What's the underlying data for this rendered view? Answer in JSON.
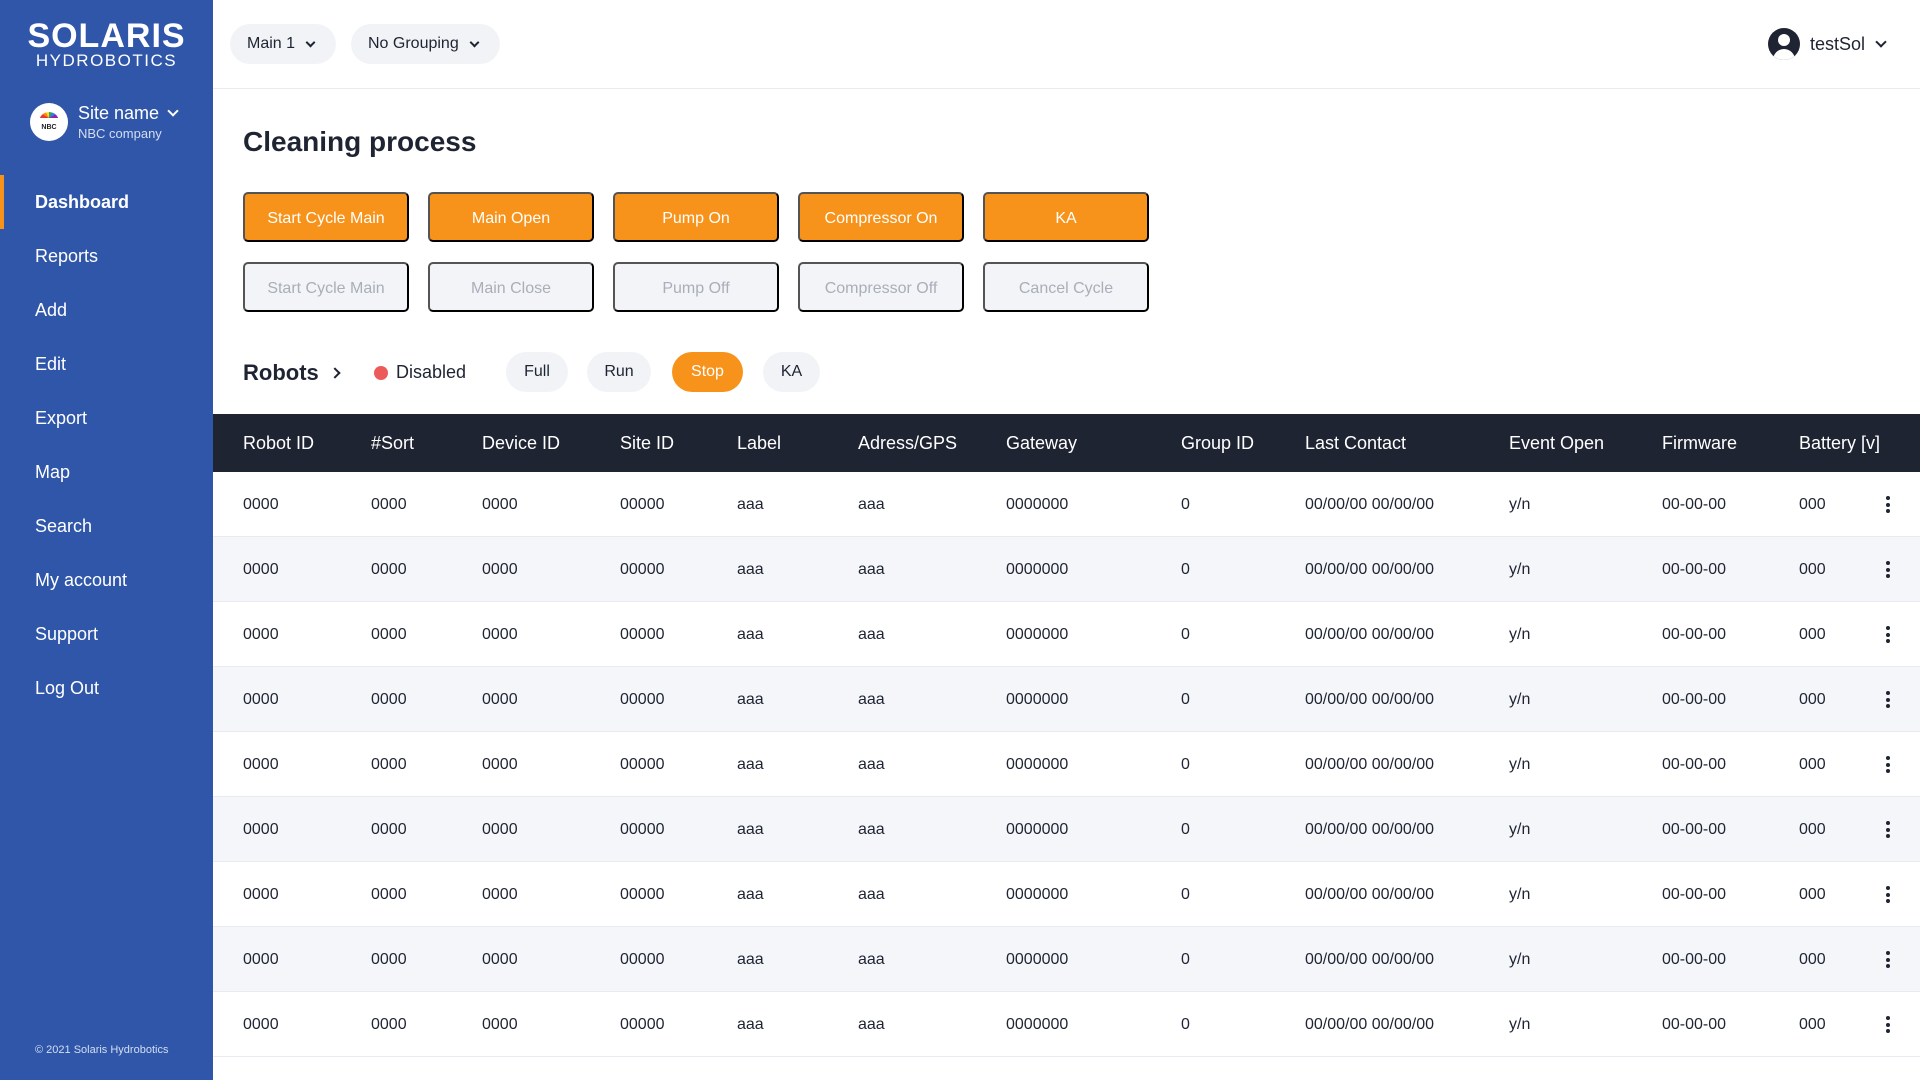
{
  "brand": {
    "name": "SOLARIS",
    "sub": "HYDROBOTICS"
  },
  "site": {
    "avatar_text": "NBC",
    "name": "Site name",
    "company": "NBC company"
  },
  "nav": [
    {
      "label": "Dashboard",
      "active": true
    },
    {
      "label": "Reports"
    },
    {
      "label": "Add"
    },
    {
      "label": "Edit"
    },
    {
      "label": "Export"
    },
    {
      "label": "Map"
    },
    {
      "label": "Search"
    },
    {
      "label": "My account"
    },
    {
      "label": "Support"
    },
    {
      "label": "Log Out"
    }
  ],
  "copyright": "© 2021 Solaris Hydrobotics",
  "topbar": {
    "main_select": "Main 1",
    "grouping_select": "No Grouping",
    "username": "testSol"
  },
  "page_title": "Cleaning process",
  "actions_primary": [
    "Start Cycle Main",
    "Main Open",
    "Pump On",
    "Compressor On",
    "KA"
  ],
  "actions_secondary": [
    "Start Cycle Main",
    "Main Close",
    "Pump Off",
    "Compressor Off",
    "Cancel Cycle"
  ],
  "robots": {
    "title": "Robots",
    "status": "Disabled",
    "filters": [
      "Full",
      "Run",
      "Stop",
      "KA"
    ],
    "active_filter": "Stop"
  },
  "colors": {
    "sidebar": "#2f56a9",
    "accent": "#f7931a",
    "table_header": "#1f2433",
    "status_disabled": "#ec5a5a"
  },
  "table": {
    "columns": [
      "Robot ID",
      "#Sort",
      "Device ID",
      "Site ID",
      "Label",
      "Adress/GPS",
      "Gateway",
      "Group ID",
      "Last Contact",
      "Event Open",
      "Firmware",
      "Battery [v]"
    ],
    "rows": [
      [
        "0000",
        "0000",
        "0000",
        "00000",
        "aaa",
        "aaa",
        "0000000",
        "0",
        "00/00/00 00/00/00",
        "y/n",
        "00-00-00",
        "000"
      ],
      [
        "0000",
        "0000",
        "0000",
        "00000",
        "aaa",
        "aaa",
        "0000000",
        "0",
        "00/00/00 00/00/00",
        "y/n",
        "00-00-00",
        "000"
      ],
      [
        "0000",
        "0000",
        "0000",
        "00000",
        "aaa",
        "aaa",
        "0000000",
        "0",
        "00/00/00 00/00/00",
        "y/n",
        "00-00-00",
        "000"
      ],
      [
        "0000",
        "0000",
        "0000",
        "00000",
        "aaa",
        "aaa",
        "0000000",
        "0",
        "00/00/00 00/00/00",
        "y/n",
        "00-00-00",
        "000"
      ],
      [
        "0000",
        "0000",
        "0000",
        "00000",
        "aaa",
        "aaa",
        "0000000",
        "0",
        "00/00/00 00/00/00",
        "y/n",
        "00-00-00",
        "000"
      ],
      [
        "0000",
        "0000",
        "0000",
        "00000",
        "aaa",
        "aaa",
        "0000000",
        "0",
        "00/00/00 00/00/00",
        "y/n",
        "00-00-00",
        "000"
      ],
      [
        "0000",
        "0000",
        "0000",
        "00000",
        "aaa",
        "aaa",
        "0000000",
        "0",
        "00/00/00 00/00/00",
        "y/n",
        "00-00-00",
        "000"
      ],
      [
        "0000",
        "0000",
        "0000",
        "00000",
        "aaa",
        "aaa",
        "0000000",
        "0",
        "00/00/00 00/00/00",
        "y/n",
        "00-00-00",
        "000"
      ],
      [
        "0000",
        "0000",
        "0000",
        "00000",
        "aaa",
        "aaa",
        "0000000",
        "0",
        "00/00/00 00/00/00",
        "y/n",
        "00-00-00",
        "000"
      ]
    ]
  }
}
